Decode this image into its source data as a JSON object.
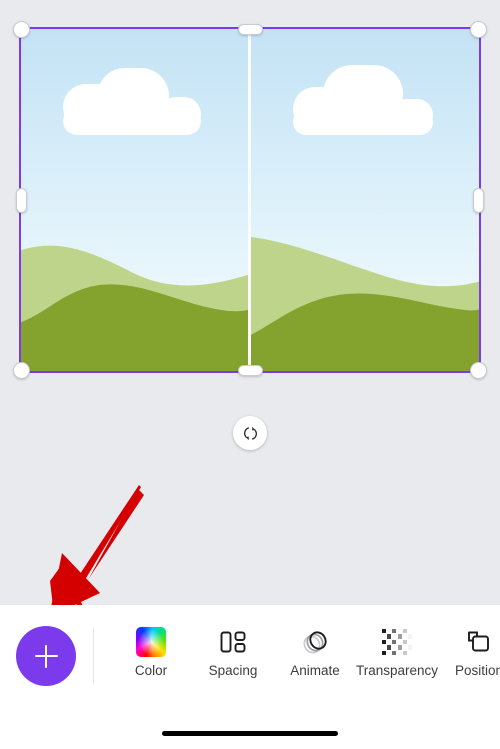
{
  "app": {
    "background_color": "#e8eaee",
    "accent_color": "#7c3aed"
  },
  "canvas": {
    "name": "design-canvas",
    "selection": {
      "border_color": "#7c3aed",
      "handle_names": [
        "resize-handle-top-left",
        "resize-handle-top-center",
        "resize-handle-top-right",
        "resize-handle-middle-left",
        "resize-handle-middle-right",
        "resize-handle-bottom-left",
        "resize-handle-bottom-center",
        "resize-handle-bottom-right"
      ]
    },
    "artwork": {
      "description": "Two side-by-side landscape illustrations",
      "sky_top_color": "#c3e2f4",
      "sky_bottom_color": "#f2fbfd",
      "hill_light_color": "#bed48a",
      "hill_dark_color": "#84a22e",
      "cloud_color": "#ffffff",
      "panels": 2
    },
    "rotate_handle": {
      "icon": "rotate-icon"
    }
  },
  "annotation": {
    "arrow_color": "#d40000",
    "points_to": "add-button"
  },
  "toolbar": {
    "add_button": {
      "icon": "plus-icon",
      "color": "#7c3aed"
    },
    "items": [
      {
        "label": "Color",
        "icon": "color-gradient-icon"
      },
      {
        "label": "Spacing",
        "icon": "spacing-icon"
      },
      {
        "label": "Animate",
        "icon": "animate-icon"
      },
      {
        "label": "Transparency",
        "icon": "transparency-checker-icon"
      },
      {
        "label": "Position",
        "icon": "position-icon"
      }
    ]
  },
  "system": {
    "home_indicator": "home-indicator-bar"
  }
}
